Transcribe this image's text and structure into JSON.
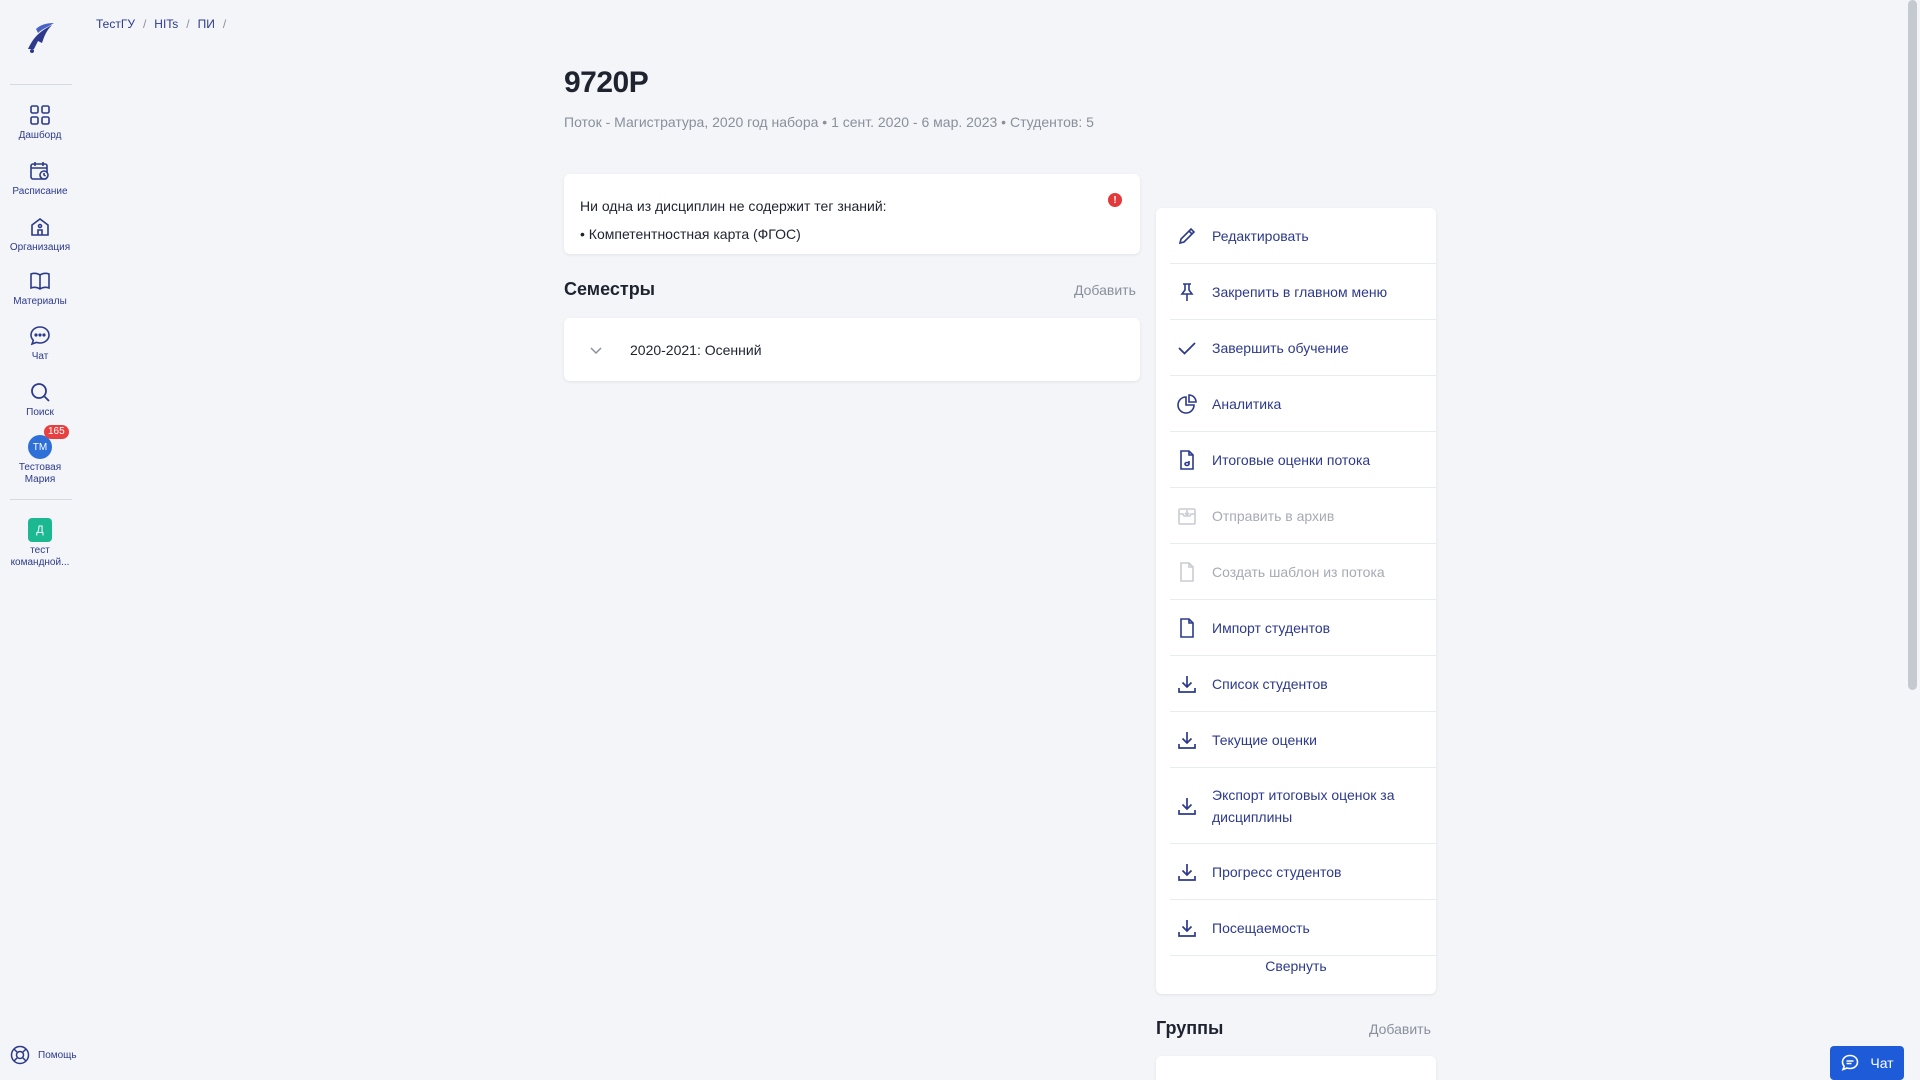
{
  "sidebar": {
    "items": [
      {
        "label": "Дашборд",
        "icon": "dashboard-icon"
      },
      {
        "label": "Расписание",
        "icon": "calendar-icon"
      },
      {
        "label": "Организация",
        "icon": "organization-icon"
      },
      {
        "label": "Материалы",
        "icon": "book-icon"
      },
      {
        "label": "Чат",
        "icon": "chat-icon"
      },
      {
        "label": "Поиск",
        "icon": "search-icon"
      }
    ],
    "user": {
      "initials": "ТМ",
      "badge": "165",
      "name_line1": "Тестовая",
      "name_line2": "Мария"
    },
    "team": {
      "initial": "Д",
      "name_line1": "тест",
      "name_line2": "командной..."
    },
    "help_label": "Помощь"
  },
  "breadcrumb": {
    "items": [
      "ТестГУ",
      "HITs",
      "ПИ"
    ],
    "separator": "/"
  },
  "page": {
    "title": "9720P",
    "subtitle": "Поток - Магистратура, 2020 год набора • 1 сент. 2020 - 6 мар. 2023 • Студентов: 5"
  },
  "warning": {
    "line1": "Ни одна из дисциплин не содержит тег знаний:",
    "line2": "• Компетентностная карта (ФГОС)",
    "indicator": "!"
  },
  "semesters": {
    "title": "Семестры",
    "add_label": "Добавить",
    "items": [
      {
        "label": "2020-2021: Осенний"
      }
    ]
  },
  "actions": {
    "items": [
      {
        "label": "Редактировать",
        "icon": "pencil-icon",
        "enabled": true
      },
      {
        "label": "Закрепить в главном меню",
        "icon": "pin-icon",
        "enabled": true
      },
      {
        "label": "Завершить обучение",
        "icon": "check-icon",
        "enabled": true
      },
      {
        "label": "Аналитика",
        "icon": "pie-chart-icon",
        "enabled": true
      },
      {
        "label": "Итоговые оценки потока",
        "icon": "document-grade-icon",
        "enabled": true
      },
      {
        "label": "Отправить в архив",
        "icon": "archive-icon",
        "enabled": false
      },
      {
        "label": "Создать шаблон из потока",
        "icon": "document-icon",
        "enabled": false
      },
      {
        "label": "Импорт студентов",
        "icon": "document-icon",
        "enabled": true
      },
      {
        "label": "Список студентов",
        "icon": "download-icon",
        "enabled": true
      },
      {
        "label": "Текущие оценки",
        "icon": "download-icon",
        "enabled": true
      },
      {
        "label": "Экспорт итоговых оценок за дисциплины",
        "icon": "download-icon",
        "enabled": true
      },
      {
        "label": "Прогресс студентов",
        "icon": "download-icon",
        "enabled": true
      },
      {
        "label": "Посещаемость",
        "icon": "download-icon",
        "enabled": true
      }
    ],
    "collapse_label": "Свернуть"
  },
  "groups": {
    "title": "Группы",
    "add_label": "Добавить"
  },
  "chat_button": {
    "label": "Чат"
  },
  "colors": {
    "accent": "#2d3a8c",
    "primary_button": "#1e5bd8",
    "badge": "#e64040",
    "team": "#1bb892"
  }
}
